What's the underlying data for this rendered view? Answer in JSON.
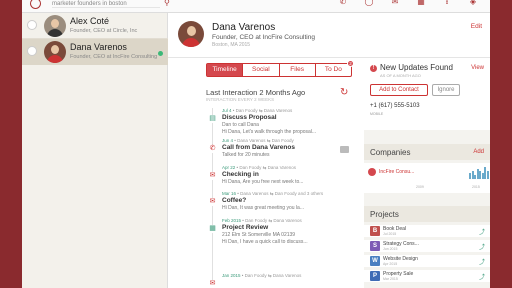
{
  "topbar": {
    "search_value": "marketer founders in boston",
    "icons": [
      "filter-icon",
      "phone-icon",
      "chat-icon",
      "mail-icon",
      "calendar-icon",
      "share-icon",
      "tag-icon"
    ]
  },
  "contacts": [
    {
      "name": "Alex Coté",
      "title": "Founder, CEO at Circle, Inc"
    },
    {
      "name": "Dana Varenos",
      "title": "Founder, CEO at IncFire Consulting"
    }
  ],
  "detail": {
    "name": "Dana Varenos",
    "title": "Founder, CEO at IncFire Consulting",
    "location": "Boston, MA 2015",
    "edit": "Edit"
  },
  "tabs": [
    "Timeline",
    "Social",
    "Files",
    "To Do"
  ],
  "tab_badge": "2",
  "last_interaction": {
    "title": "Last Interaction 2 Months Ago",
    "subtitle": "INTERACTION EVERY 2 WEEKS"
  },
  "timeline": [
    {
      "date": "Jul 4",
      "meta": " • Dan Foody  ⇆  Dana Varenos",
      "heading": "Discuss Proposal",
      "body": "Dan to call Dana",
      "body2": "Hi Dana, Let's walk through the proposal...",
      "icon": "task-icon",
      "color": "#3a9a7a"
    },
    {
      "date": "Jun 4",
      "meta": " • Dana Varenos  ⇆  Dan Foody",
      "heading": "Call from Dana Varenos",
      "body": "Talked for 20 minutes",
      "body2": "",
      "icon": "phone-call-icon",
      "color": "#c33"
    },
    {
      "date": "Apr 22",
      "meta": " • Dan Foody  ⇆  Dana Varenos",
      "heading": "Checking in",
      "body": "Hi Dana, Are you free next week to...",
      "body2": "",
      "icon": "email-icon",
      "color": "#c33"
    },
    {
      "date": "Mar 16",
      "meta": " • Dana Varenos  ⇆  Dan Foody and 3 others",
      "heading": "Coffee?",
      "body": "Hi Dan, It was great meeting you la...",
      "body2": "",
      "icon": "email-icon",
      "color": "#c33"
    },
    {
      "date": "Feb 2015",
      "meta": " • Dan Foody  ⇆  Dana Varenos",
      "heading": "Project Review",
      "body": "212 Elm St Somerville MA 02139",
      "body2": "Hi Dan, I have a quick call to discuss...",
      "icon": "calendar-event-icon",
      "color": "#3a9a7a"
    },
    {
      "date": "Jan 2015",
      "meta": " • Dan Foody  ⇆  Dana Varenos",
      "heading": "",
      "body": "",
      "body2": "",
      "icon": "email-icon",
      "color": "#c33"
    }
  ],
  "new_updates": {
    "title": "New Updates Found",
    "subtitle": "AS OF A MONTH AGO",
    "view": "View",
    "add_button": "Add to Contact",
    "ignore_button": "Ignore",
    "phone": "+1 (617) 555-5103",
    "phone_label": "MOBILE"
  },
  "companies": {
    "title": "Companies",
    "add": "Add",
    "items": [
      {
        "name": "IncFire Consu...",
        "date_start": "2009",
        "date_end": "2015"
      }
    ],
    "activity": [
      3,
      4,
      2,
      5,
      4,
      3,
      6,
      4
    ]
  },
  "projects": {
    "title": "Projects",
    "items": [
      {
        "letter": "B",
        "name": "Book Deal",
        "date": "Jul 2015",
        "color": "#c0504d"
      },
      {
        "letter": "S",
        "name": "Strategy Cons...",
        "date": "Jun 2015",
        "color": "#7d5ab5"
      },
      {
        "letter": "W",
        "name": "Website Design",
        "date": "Apr 2015",
        "color": "#4a7fc1"
      },
      {
        "letter": "P",
        "name": "Property Sale",
        "date": "Mar 2015",
        "color": "#3f6bb5"
      }
    ]
  }
}
